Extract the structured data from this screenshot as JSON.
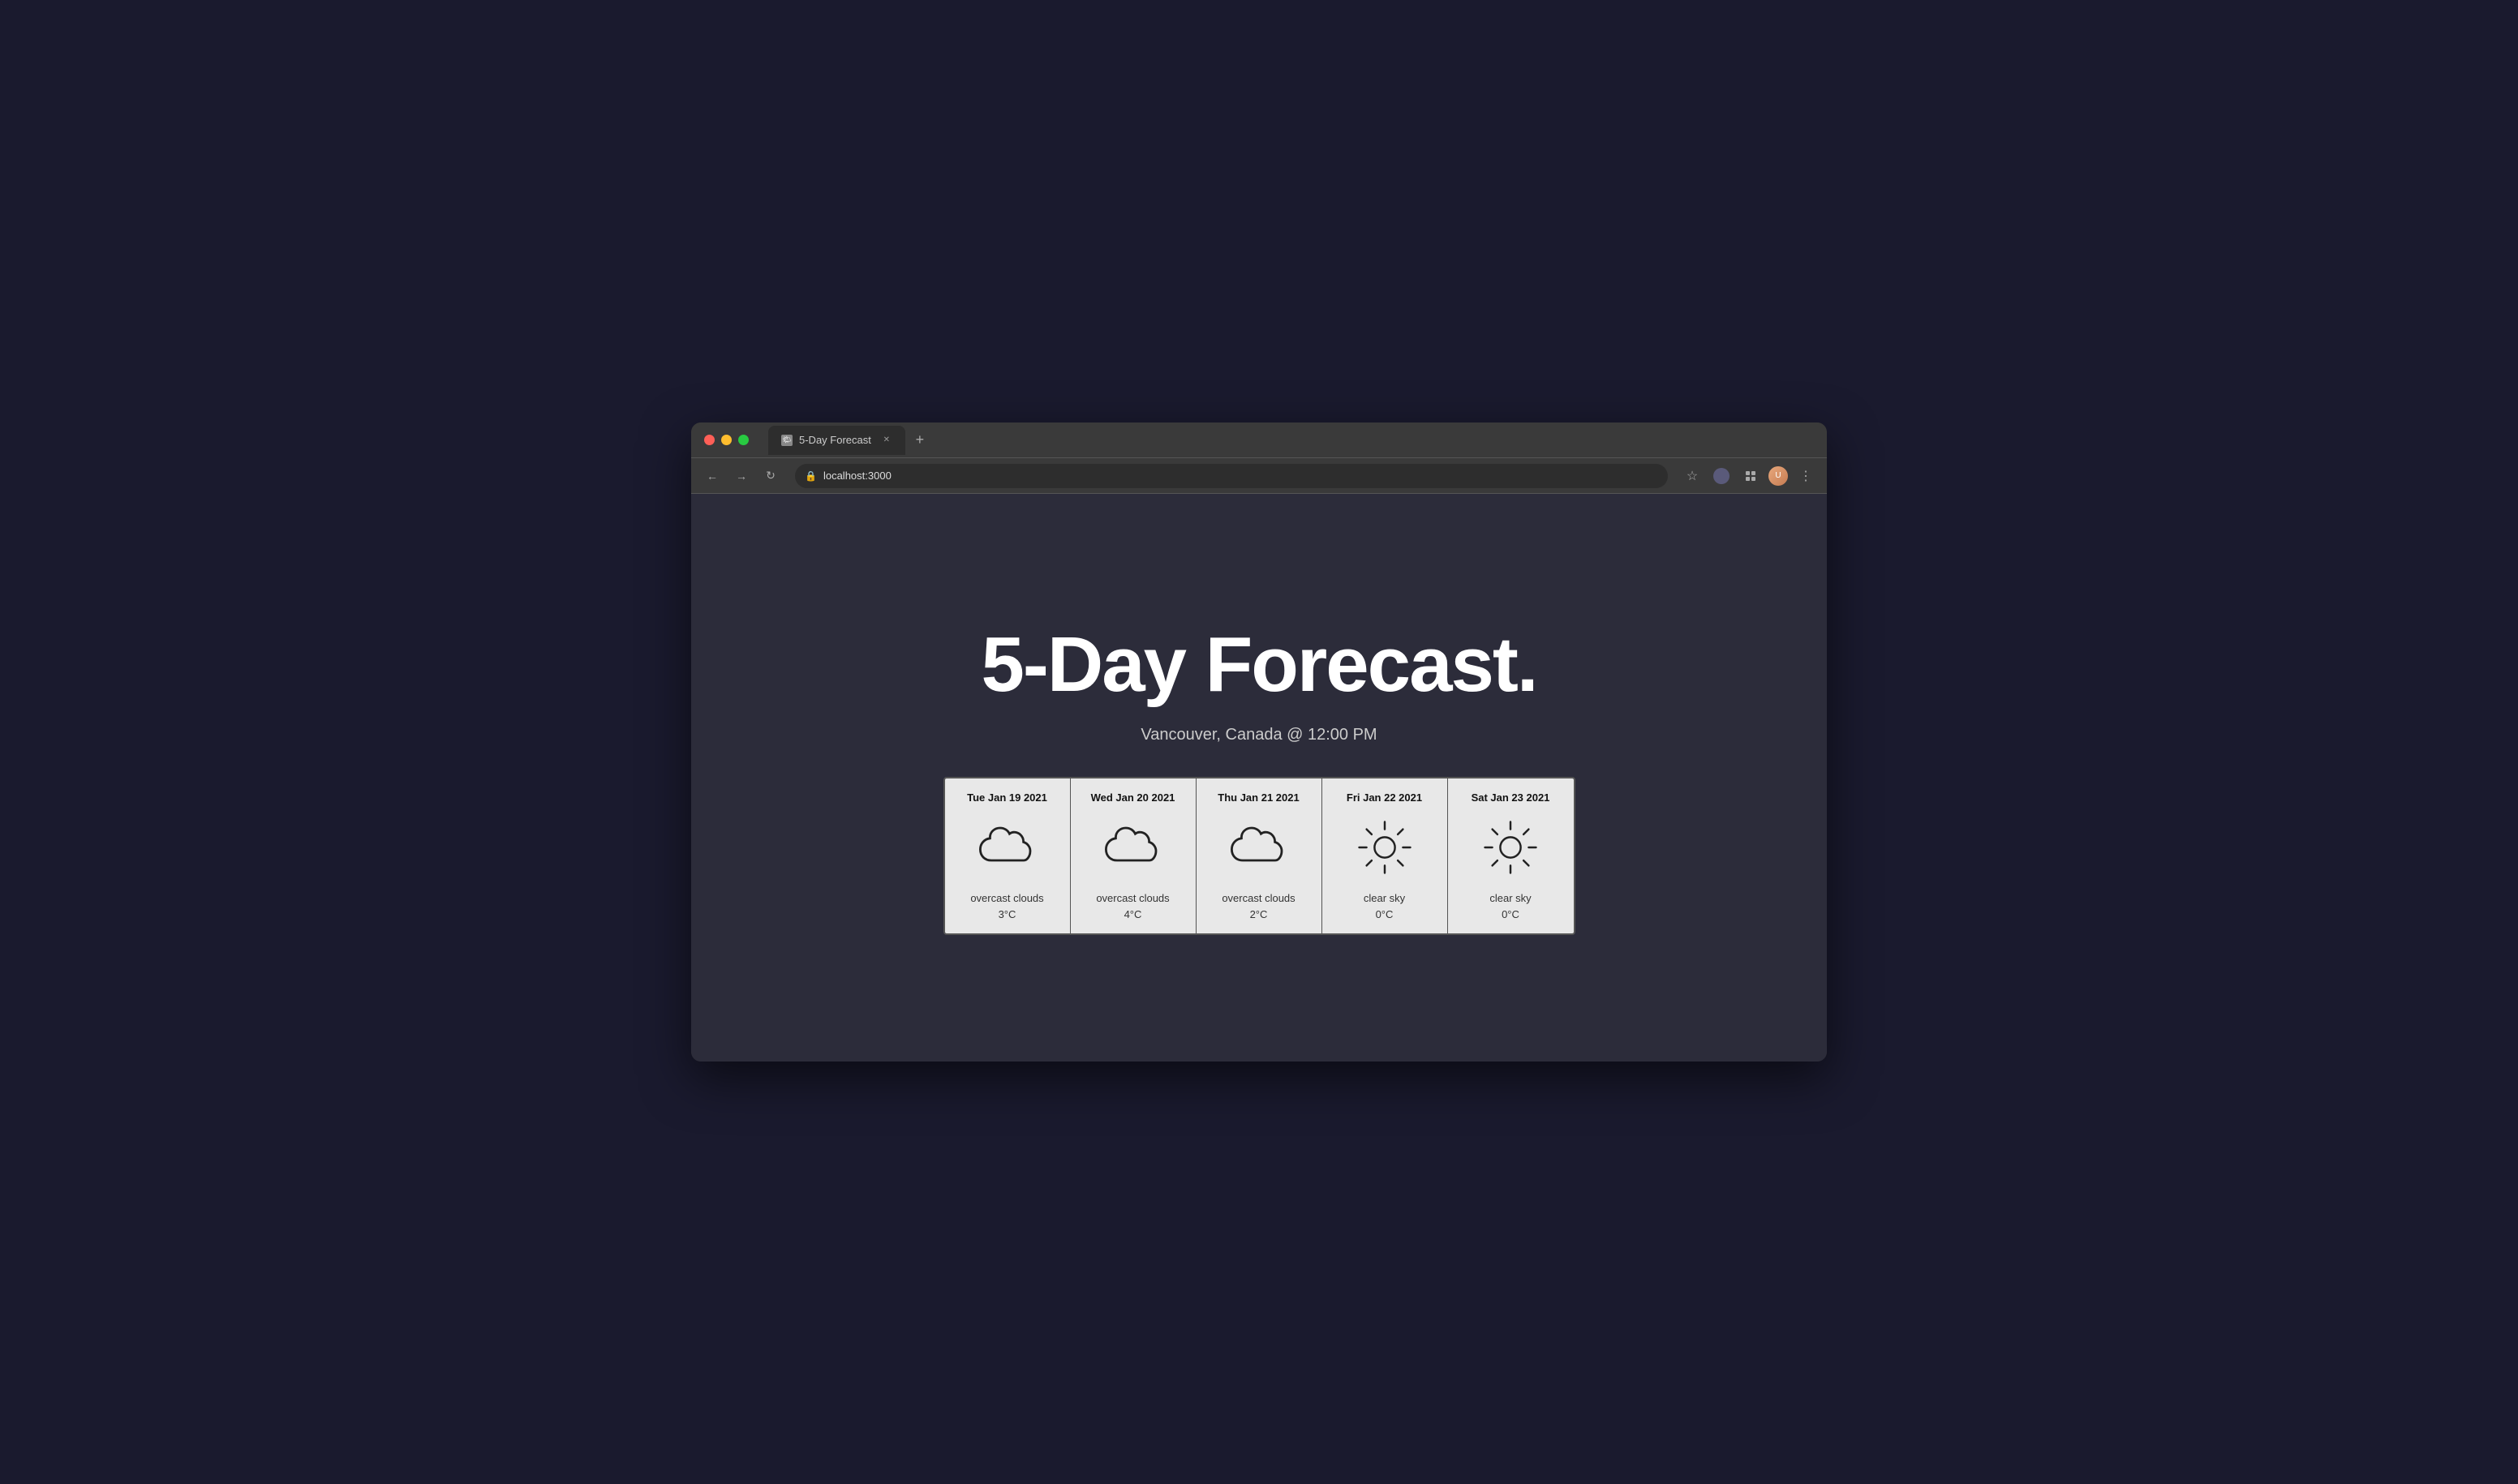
{
  "browser": {
    "tab_title": "5-Day Forecast",
    "url": "localhost:3000",
    "new_tab_label": "+",
    "nav": {
      "back": "←",
      "forward": "→",
      "refresh": "↻"
    }
  },
  "page": {
    "title": "5-Day Forecast.",
    "location": "Vancouver, Canada @ 12:00 PM",
    "forecast": [
      {
        "date": "Tue Jan 19 2021",
        "icon": "cloud",
        "condition": "overcast clouds",
        "temp": "3°C"
      },
      {
        "date": "Wed Jan 20 2021",
        "icon": "cloud",
        "condition": "overcast clouds",
        "temp": "4°C"
      },
      {
        "date": "Thu Jan 21 2021",
        "icon": "cloud",
        "condition": "overcast clouds",
        "temp": "2°C"
      },
      {
        "date": "Fri Jan 22 2021",
        "icon": "sun",
        "condition": "clear sky",
        "temp": "0°C"
      },
      {
        "date": "Sat Jan 23 2021",
        "icon": "sun",
        "condition": "clear sky",
        "temp": "0°C"
      }
    ]
  }
}
